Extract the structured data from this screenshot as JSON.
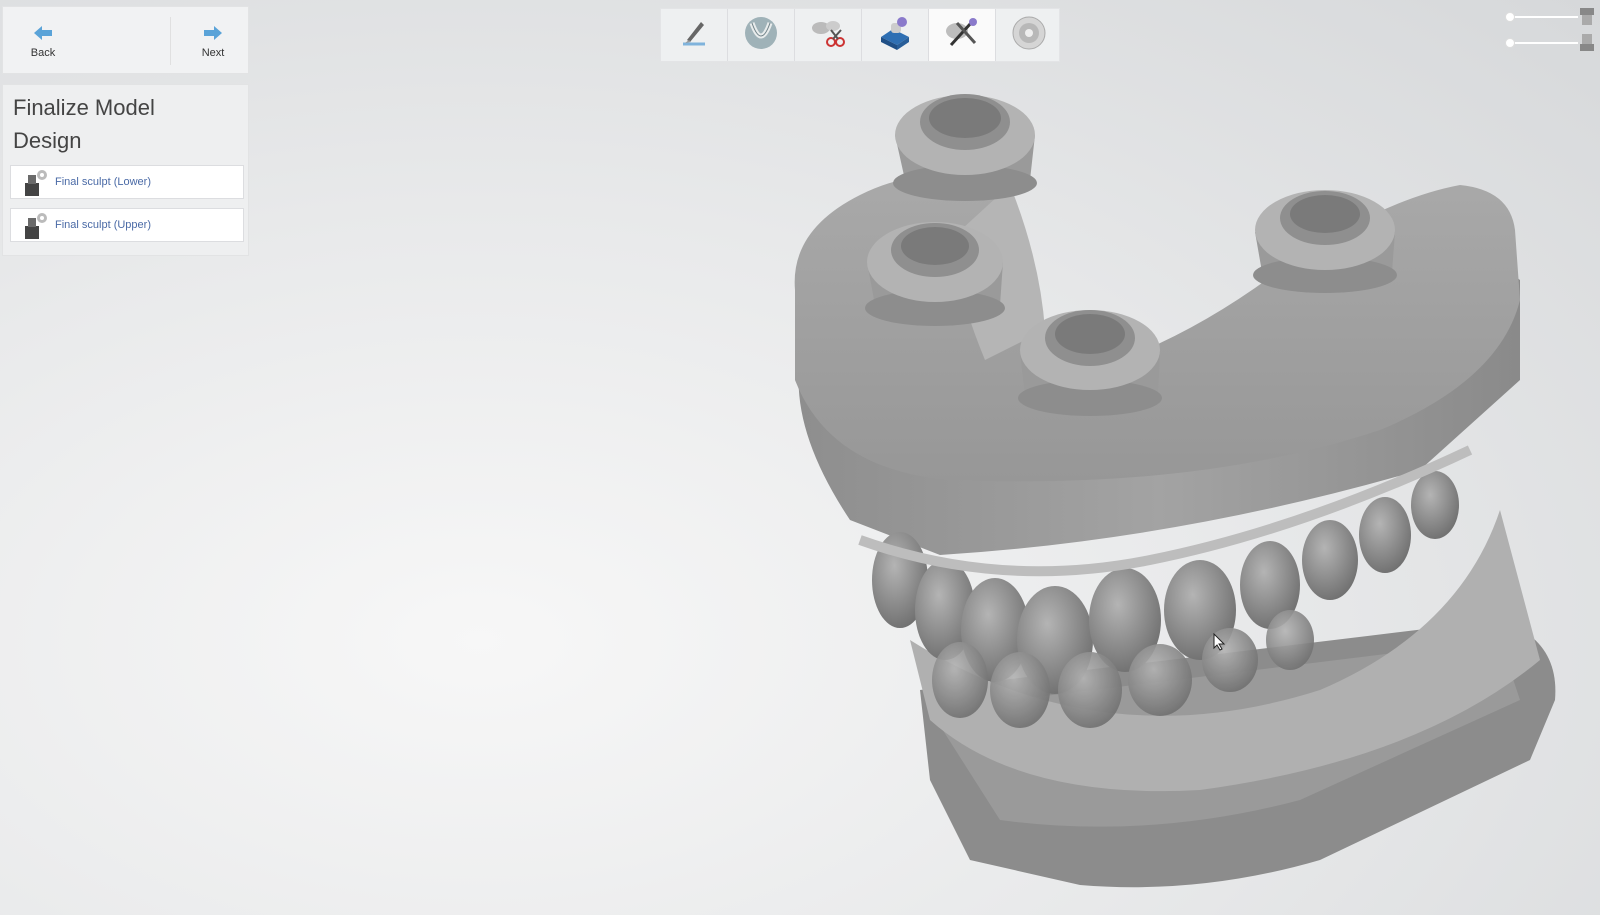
{
  "nav": {
    "back_label": "Back",
    "next_label": "Next"
  },
  "panel": {
    "title": "Finalize Model Design",
    "steps": [
      {
        "label": "Final sculpt (Lower)",
        "icon": "sculpt-lower-icon"
      },
      {
        "label": "Final sculpt (Upper)",
        "icon": "sculpt-upper-icon"
      }
    ]
  },
  "toolbar": {
    "tools": [
      {
        "icon": "trim-blade-icon"
      },
      {
        "icon": "arch-icon"
      },
      {
        "icon": "cut-scissors-icon"
      },
      {
        "icon": "base-block-icon"
      },
      {
        "icon": "sculpt-tools-icon",
        "active": true
      },
      {
        "icon": "disc-icon"
      }
    ]
  },
  "colors": {
    "accent": "#5aa3d8",
    "link": "#4a6aa6",
    "model": "#9b9b9b"
  }
}
